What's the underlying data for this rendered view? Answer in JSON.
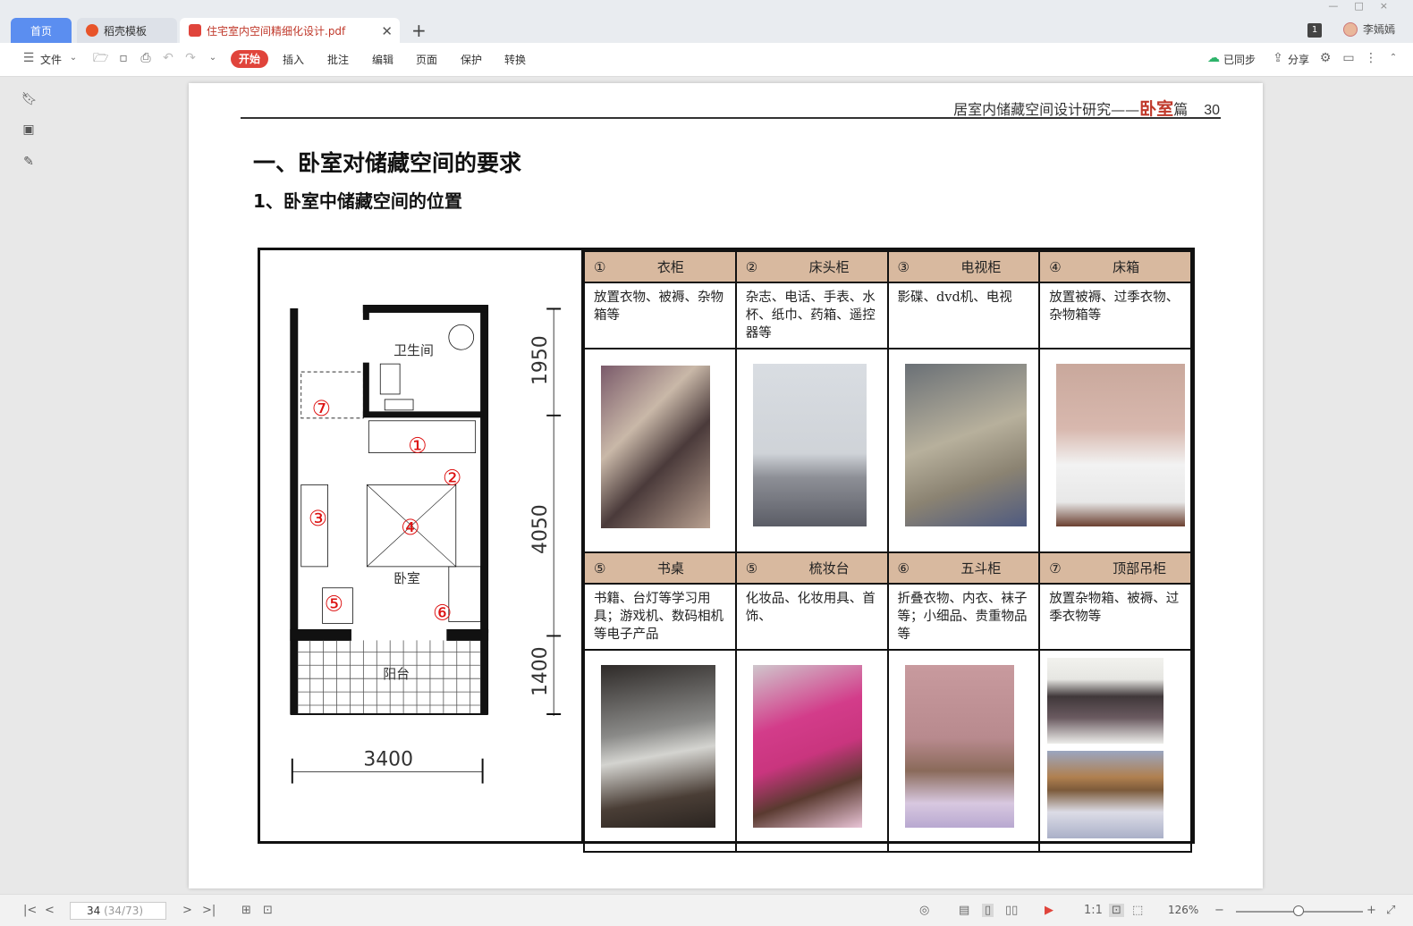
{
  "tabs": {
    "home": "首页",
    "template": "稻壳模板",
    "document": "住宅室内空间精细化设计.pdf",
    "new_tab": "+"
  },
  "window": {
    "page_badge": "1",
    "user_name": "李嫣嫣"
  },
  "toolbar": {
    "file": "文件",
    "start": "开始",
    "insert": "插入",
    "annotate": "批注",
    "edit": "编辑",
    "page": "页面",
    "protect": "保护",
    "convert": "转换",
    "synced": "已同步",
    "share": "分享"
  },
  "document": {
    "running_head_prefix": "居室内储藏空间设计研究——",
    "running_head_highlight": "卧室",
    "running_head_suffix": "篇",
    "page_number": "30",
    "heading1": "一、卧室对储藏空间的要求",
    "heading2": "1、卧室中储藏空间的位置",
    "plan": {
      "labels": [
        "卫生间",
        "卧室",
        "阳台"
      ],
      "markers": [
        "⑦",
        "①",
        "②",
        "③",
        "④",
        "⑤",
        "⑥"
      ],
      "dimensions": [
        "1950",
        "4050",
        "1400",
        "3400"
      ]
    },
    "items_row1": [
      {
        "num": "①",
        "name": "衣柜",
        "desc": "放置衣物、被褥、杂物箱等"
      },
      {
        "num": "②",
        "name": "床头柜",
        "desc": "杂志、电话、手表、水杯、纸巾、药箱、遥控器等"
      },
      {
        "num": "③",
        "name": "电视柜",
        "desc": "影碟、dvd机、电视"
      },
      {
        "num": "④",
        "name": "床箱",
        "desc": "放置被褥、过季衣物、杂物箱等"
      }
    ],
    "items_row2": [
      {
        "num": "⑤",
        "name": "书桌",
        "desc": "书籍、台灯等学习用具；游戏机、数码相机等电子产品"
      },
      {
        "num": "⑤",
        "name": "梳妆台",
        "desc": "化妆品、化妆用具、首饰、"
      },
      {
        "num": "⑥",
        "name": "五斗柜",
        "desc": "折叠衣物、内衣、袜子等；小细品、贵重物品等"
      },
      {
        "num": "⑦",
        "name": "顶部吊柜",
        "desc": "放置杂物箱、被褥、过季衣物等"
      }
    ]
  },
  "statusbar": {
    "page_current": "34",
    "page_total": "(34/73)",
    "zoom": "126%"
  },
  "colors": {
    "table_header": "#d8b99f",
    "accent_red": "#c0392b",
    "tab_active_blue": "#5b8ef0"
  }
}
